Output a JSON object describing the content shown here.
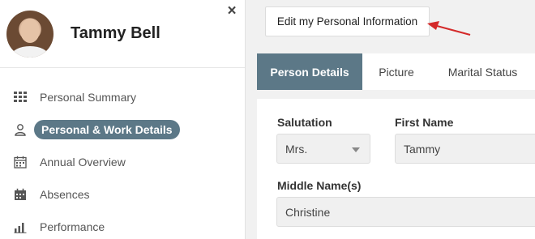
{
  "profile": {
    "name": "Tammy Bell",
    "close_symbol": "×"
  },
  "sidebar": {
    "items": [
      {
        "label": "Personal Summary",
        "icon": "grid-icon",
        "active": false
      },
      {
        "label": "Personal & Work Details",
        "icon": "person-icon",
        "active": true
      },
      {
        "label": "Annual Overview",
        "icon": "calendar-icon",
        "active": false
      },
      {
        "label": "Absences",
        "icon": "calendar-dark-icon",
        "active": false
      },
      {
        "label": "Performance",
        "icon": "bar-chart-icon",
        "active": false
      }
    ]
  },
  "actions": {
    "edit_label": "Edit my Personal Information"
  },
  "tabs": [
    {
      "label": "Person Details",
      "active": true
    },
    {
      "label": "Picture",
      "active": false
    },
    {
      "label": "Marital Status",
      "active": false
    }
  ],
  "form": {
    "salutation": {
      "label": "Salutation",
      "value": "Mrs."
    },
    "first_name": {
      "label": "First Name",
      "value": "Tammy"
    },
    "middle_name": {
      "label": "Middle Name(s)",
      "value": "Christine"
    }
  },
  "colors": {
    "accent": "#5c7887",
    "arrow": "#d42a2a"
  }
}
